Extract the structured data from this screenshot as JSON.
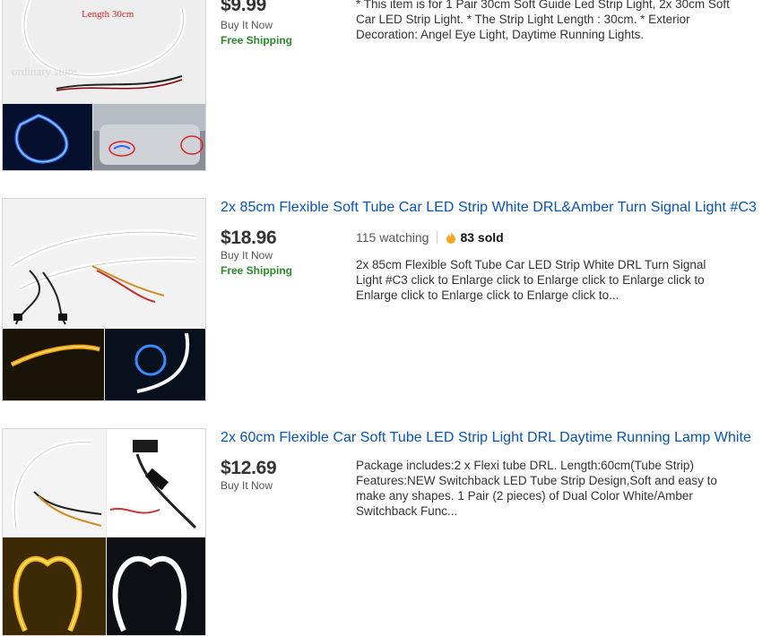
{
  "listings": [
    {
      "title": "",
      "price": "$9.99",
      "format": "Buy It Now",
      "shipping": "Free Shipping",
      "description": "* This item is for 1 Pair 30cm Soft Guide Led Strip Light, 2x 30cm Soft Car LED Strip Light. * The Strip Light Length : 30cm. * Exterior Decoration: Angel Eye Light, Daytime Running Lights.",
      "image_caption": "Length 30cm",
      "image_watermark": "ordinary store"
    },
    {
      "title": "2x 85cm Flexible Soft Tube Car LED Strip White DRL&Amber Turn Signal Light #C3",
      "price": "$18.96",
      "format": "Buy It Now",
      "shipping": "Free Shipping",
      "watching": "115 watching",
      "sold": "83 sold",
      "description": "2x 85cm Flexible Soft Tube Car LED Strip White DRL Turn Signal Light #C3 click to Enlarge click to Enlarge click to Enlarge click to Enlarge click to Enlarge click to Enlarge click to..."
    },
    {
      "title": "2x 60cm Flexible Car Soft Tube LED Strip Light DRL Daytime Running Lamp White",
      "price": "$12.69",
      "format": "Buy It Now",
      "description": "Package includes:2 x Flexi tube DRL. Length:60cm(Tube Strip) Features:NEW Switchback LED Tube Strip Design,Soft and easy to make any shapes. 1 Pair (2 pieces) of Dual Color White/Amber Switchback Func..."
    }
  ],
  "colors": {
    "link": "#0654ba",
    "free_shipping": "#2a8a2a",
    "hot_flame": "#f5a623"
  }
}
